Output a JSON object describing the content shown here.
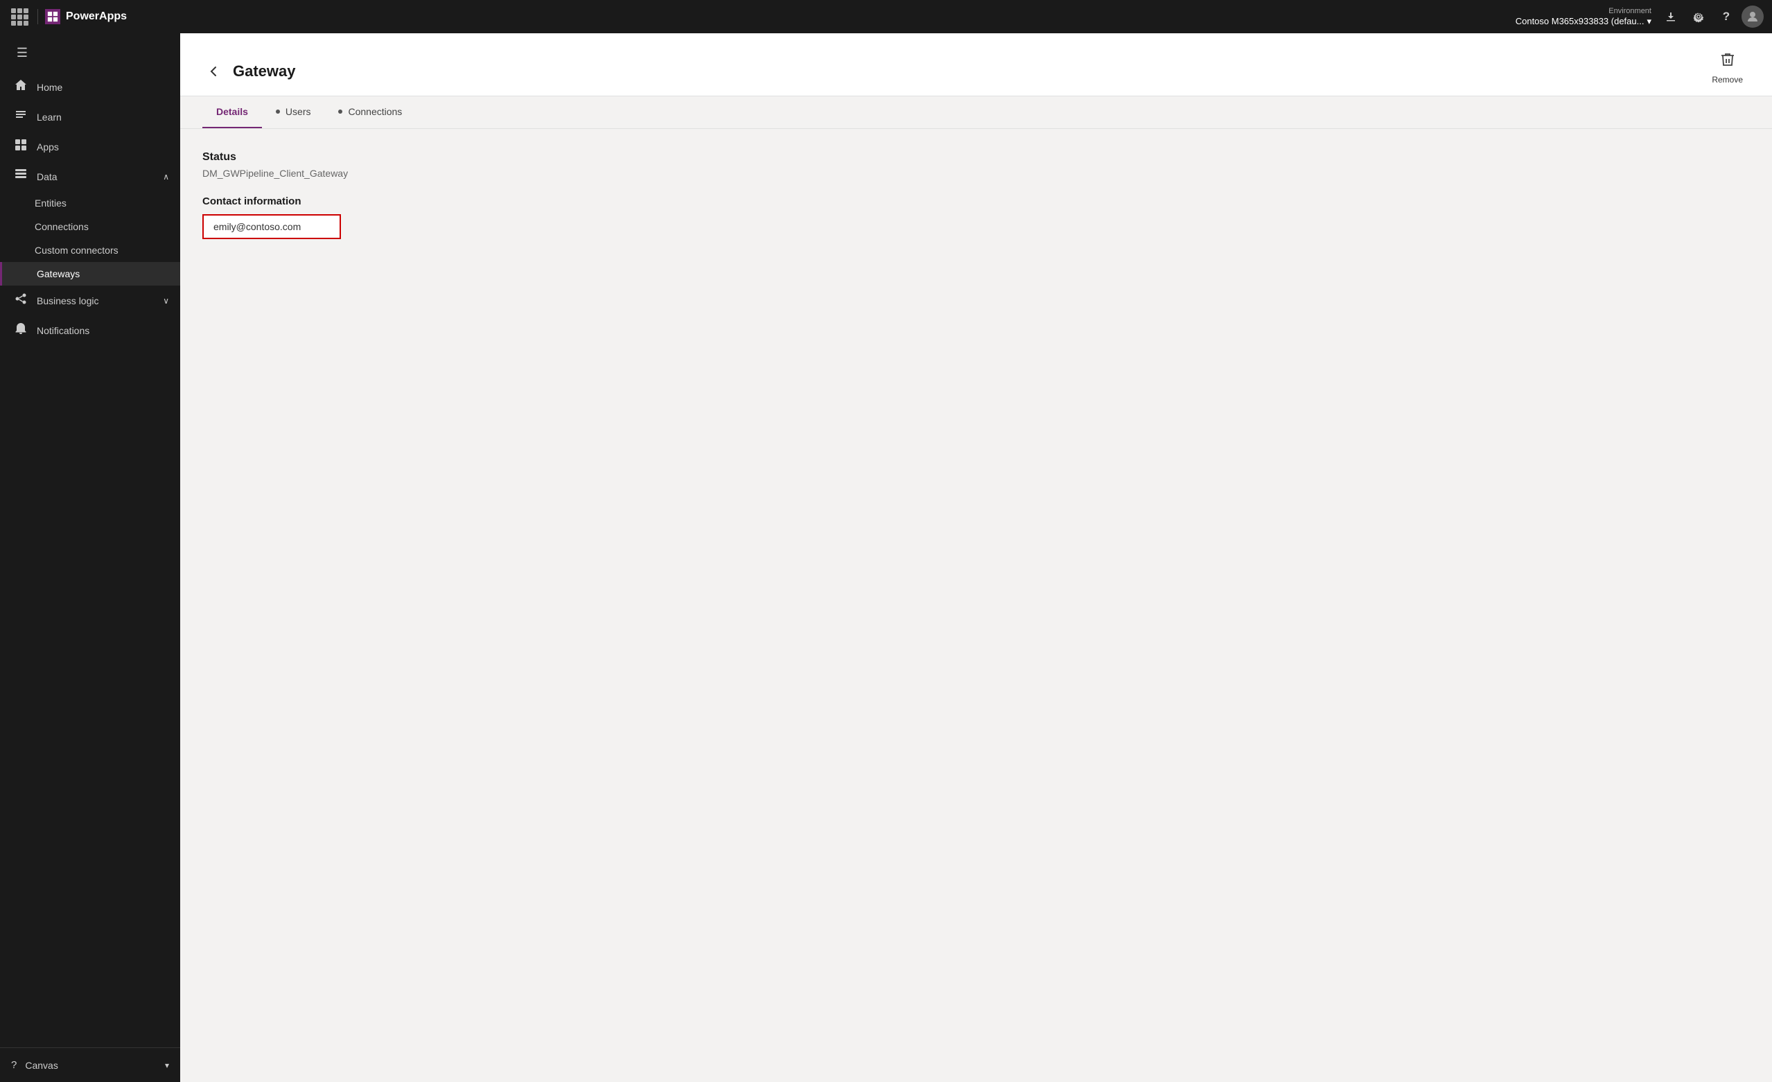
{
  "topbar": {
    "app_name": "PowerApps",
    "environment_label": "Environment",
    "environment_value": "Contoso M365x933833 (defau...",
    "download_icon": "⬇",
    "settings_icon": "⚙",
    "help_icon": "?",
    "avatar_initials": ""
  },
  "sidebar": {
    "hamburger_icon": "☰",
    "items": [
      {
        "id": "home",
        "label": "Home",
        "icon": "🏠",
        "active": false
      },
      {
        "id": "learn",
        "label": "Learn",
        "icon": "📖",
        "active": false
      },
      {
        "id": "apps",
        "label": "Apps",
        "icon": "📱",
        "active": false
      },
      {
        "id": "data",
        "label": "Data",
        "icon": "🗃",
        "active": false,
        "expanded": true
      }
    ],
    "sub_items": [
      {
        "id": "entities",
        "label": "Entities",
        "active": false
      },
      {
        "id": "connections",
        "label": "Connections",
        "active": false
      },
      {
        "id": "custom-connectors",
        "label": "Custom connectors",
        "active": false
      },
      {
        "id": "gateways",
        "label": "Gateways",
        "active": true
      }
    ],
    "more_items": [
      {
        "id": "business-logic",
        "label": "Business logic",
        "icon": "⚡",
        "active": false
      },
      {
        "id": "notifications",
        "label": "Notifications",
        "icon": "🔔",
        "active": false
      }
    ],
    "bottom_items": [
      {
        "id": "canvas",
        "label": "Canvas",
        "icon": "?"
      }
    ]
  },
  "page": {
    "title": "Gateway",
    "back_label": "←",
    "remove_label": "Remove"
  },
  "tabs": [
    {
      "id": "details",
      "label": "Details",
      "active": true,
      "has_dot": false
    },
    {
      "id": "users",
      "label": "Users",
      "active": false,
      "has_dot": true
    },
    {
      "id": "connections",
      "label": "Connections",
      "active": false,
      "has_dot": true
    }
  ],
  "details": {
    "status_label": "Status",
    "status_value": "DM_GWPipeline_Client_Gateway",
    "contact_info_label": "Contact information",
    "contact_email": "emily@contoso.com"
  }
}
